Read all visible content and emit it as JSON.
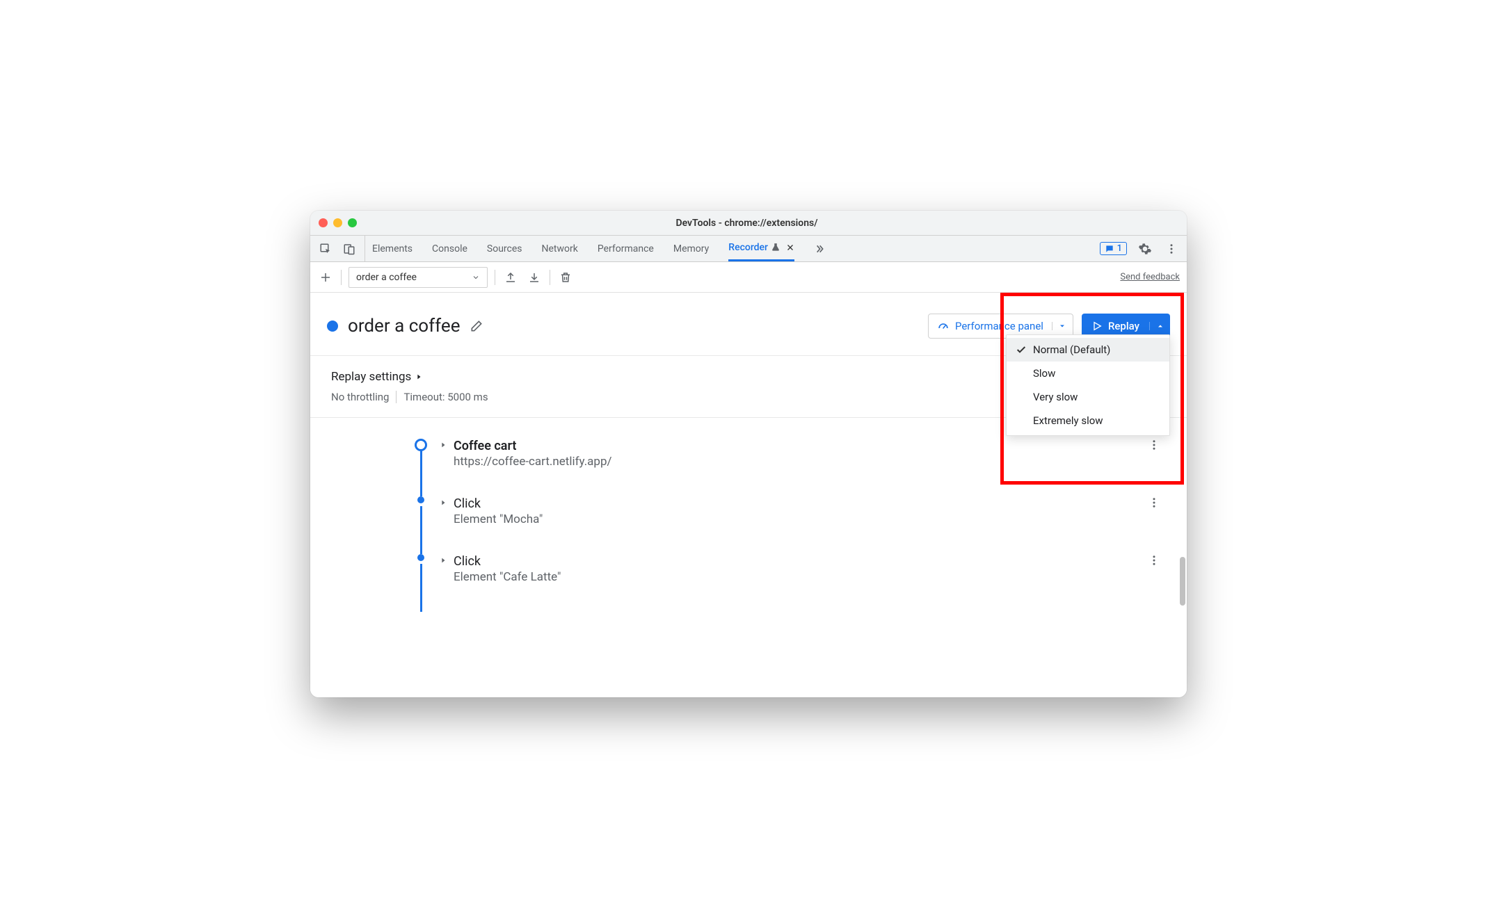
{
  "window": {
    "title": "DevTools - chrome://extensions/"
  },
  "tabs": {
    "items": [
      "Elements",
      "Console",
      "Sources",
      "Network",
      "Performance",
      "Memory",
      "Recorder"
    ],
    "active_index": 6,
    "badge_count": "1"
  },
  "toolbar": {
    "recording_name": "order a coffee",
    "feedback": "Send feedback"
  },
  "header": {
    "title": "order a coffee",
    "performance_panel": "Performance panel",
    "replay": "Replay"
  },
  "replay_speed_menu": {
    "options": [
      "Normal (Default)",
      "Slow",
      "Very slow",
      "Extremely slow"
    ],
    "selected_index": 0
  },
  "settings": {
    "title": "Replay settings",
    "throttling": "No throttling",
    "timeout": "Timeout: 5000 ms"
  },
  "steps": [
    {
      "title": "Coffee cart",
      "subtitle": "https://coffee-cart.netlify.app/",
      "start": true,
      "bold": true
    },
    {
      "title": "Click",
      "subtitle": "Element \"Mocha\"",
      "start": false,
      "bold": false
    },
    {
      "title": "Click",
      "subtitle": "Element \"Cafe Latte\"",
      "start": false,
      "bold": false
    }
  ]
}
